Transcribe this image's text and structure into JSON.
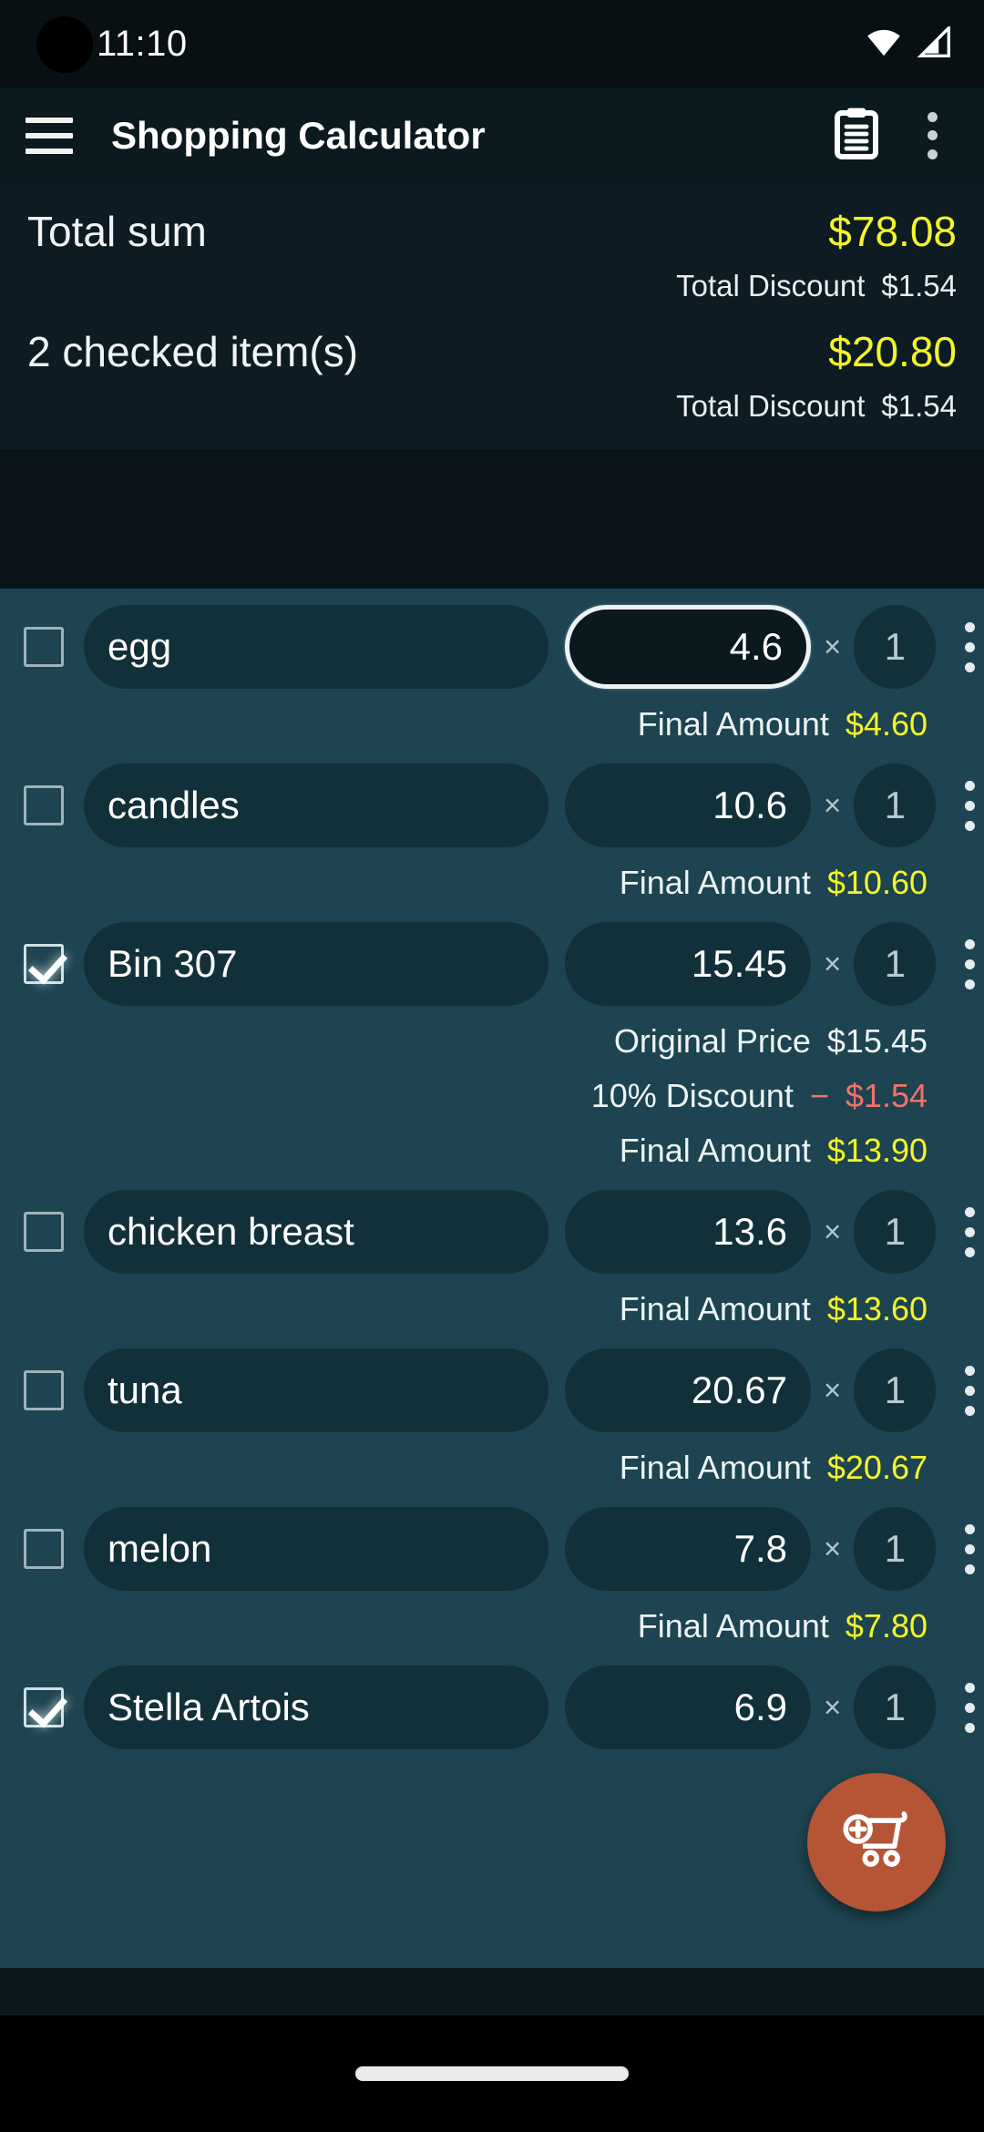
{
  "status_bar": {
    "time": "11:10",
    "icons": [
      "wifi-icon",
      "cell-signal-icon"
    ]
  },
  "app_bar": {
    "menu_icon": "hamburger-menu-icon",
    "title": "Shopping Calculator",
    "notes_icon": "clipboard-notes-icon",
    "overflow_icon": "overflow-menu-icon"
  },
  "summary": {
    "total_label": "Total sum",
    "total_value": "$78.08",
    "total_discount_label": "Total Discount",
    "total_discount_value": "$1.54",
    "checked_label": "2 checked item(s)",
    "checked_value": "$20.80",
    "checked_discount_label": "Total Discount",
    "checked_discount_value": "$1.54"
  },
  "labels": {
    "times": "×",
    "final_amount": "Final Amount",
    "original_price": "Original Price",
    "discount_percent": "10% Discount",
    "minus": "−"
  },
  "colors": {
    "accent_amount": "#f5f528",
    "discount": "#f0736b",
    "fab": "#b55535",
    "list_bg": "#1d4450",
    "field_bg": "#123039"
  },
  "fab": {
    "icon": "add-to-cart-icon"
  },
  "items": [
    {
      "name": "egg",
      "price": "4.6",
      "qty": "1",
      "checked": false,
      "focused": true,
      "final_amount": "$4.60"
    },
    {
      "name": "candles",
      "price": "10.6",
      "qty": "1",
      "checked": false,
      "focused": false,
      "final_amount": "$10.60"
    },
    {
      "name": "Bin 307",
      "price": "15.45",
      "qty": "1",
      "checked": true,
      "focused": false,
      "original_price": "$15.45",
      "discount_label": "10% Discount",
      "discount_value": "$1.54",
      "final_amount": "$13.90"
    },
    {
      "name": "chicken breast",
      "price": "13.6",
      "qty": "1",
      "checked": false,
      "focused": false,
      "final_amount": "$13.60"
    },
    {
      "name": "tuna",
      "price": "20.67",
      "qty": "1",
      "checked": false,
      "focused": false,
      "final_amount": "$20.67"
    },
    {
      "name": "melon",
      "price": "7.8",
      "qty": "1",
      "checked": false,
      "focused": false,
      "final_amount": "$7.80"
    },
    {
      "name": "Stella Artois",
      "price": "6.9",
      "qty": "1",
      "checked": true,
      "focused": false,
      "final_amount": ""
    }
  ]
}
